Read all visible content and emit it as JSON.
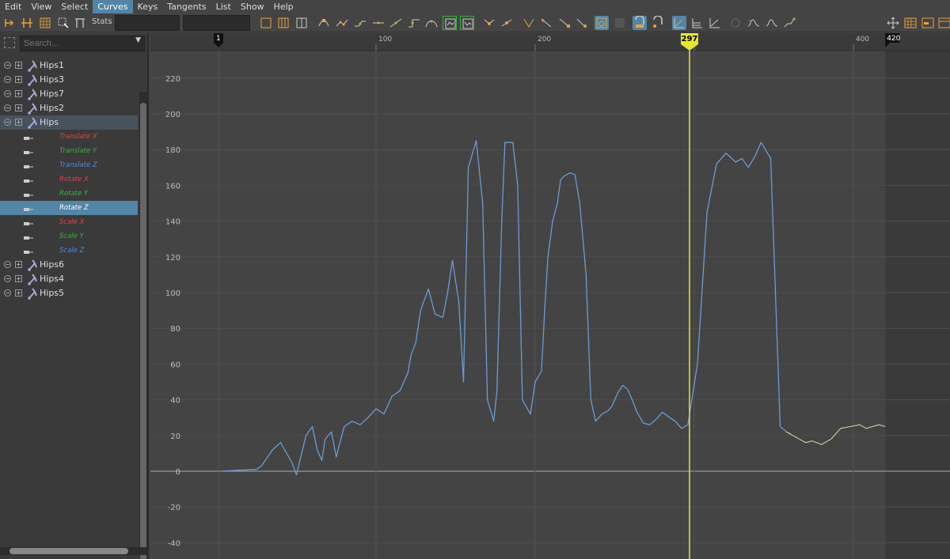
{
  "menu": [
    {
      "label": "Edit",
      "active": false
    },
    {
      "label": "View",
      "active": false
    },
    {
      "label": "Select",
      "active": false
    },
    {
      "label": "Curves",
      "active": true
    },
    {
      "label": "Keys",
      "active": false
    },
    {
      "label": "Tangents",
      "active": false
    },
    {
      "label": "List",
      "active": false
    },
    {
      "label": "Show",
      "active": false
    },
    {
      "label": "Help",
      "active": false
    }
  ],
  "toolbar": {
    "stats_label": "Stats"
  },
  "outliner": {
    "search_placeholder": "Search...",
    "items": [
      {
        "label": "Hips1",
        "type": "joint"
      },
      {
        "label": "Hips3",
        "type": "joint"
      },
      {
        "label": "Hips7",
        "type": "joint"
      },
      {
        "label": "Hips2",
        "type": "joint"
      },
      {
        "label": "Hips",
        "type": "joint",
        "highlighted": true
      },
      {
        "label": "Translate X",
        "type": "channel",
        "axis": "x"
      },
      {
        "label": "Translate Y",
        "type": "channel",
        "axis": "y"
      },
      {
        "label": "Translate Z",
        "type": "channel",
        "axis": "z"
      },
      {
        "label": "Rotate X",
        "type": "channel",
        "axis": "x"
      },
      {
        "label": "Rotate Y",
        "type": "channel",
        "axis": "y"
      },
      {
        "label": "Rotate Z",
        "type": "channel",
        "axis": "z",
        "selected": true
      },
      {
        "label": "Scale X",
        "type": "channel",
        "axis": "x"
      },
      {
        "label": "Scale Y",
        "type": "channel",
        "axis": "y"
      },
      {
        "label": "Scale Z",
        "type": "channel",
        "axis": "z"
      },
      {
        "label": "Hips6",
        "type": "joint"
      },
      {
        "label": "Hips4",
        "type": "joint"
      },
      {
        "label": "Hips5",
        "type": "joint"
      }
    ]
  },
  "graph": {
    "start_frame": "1",
    "end_frame": "420",
    "current_frame": "297",
    "x_ticks": [
      100,
      200,
      300,
      400
    ],
    "x_tick_labels": [
      "100",
      "200",
      "",
      "400"
    ],
    "y_ticks": [
      220,
      200,
      180,
      160,
      140,
      120,
      100,
      80,
      60,
      40,
      20,
      0,
      -20,
      -40
    ],
    "colors": {
      "curve": "#6b9bd6",
      "curve_tail": "#d4cf9a",
      "current_time": "#e6e62e",
      "background": "#444444",
      "out_of_range": "#3a3a3a"
    }
  },
  "chart_data": {
    "type": "line",
    "title": "",
    "xlabel": "",
    "ylabel": "",
    "xlim": [
      -40,
      460
    ],
    "ylim": [
      -50,
      230
    ],
    "series": [
      {
        "x": [
          1,
          25,
          28,
          35,
          40,
          47,
          50,
          56,
          60,
          63,
          66,
          68,
          72,
          75,
          80,
          85,
          90,
          95,
          100,
          105,
          110,
          115,
          120,
          122,
          125,
          128,
          130,
          133,
          137,
          142,
          145,
          148,
          152,
          155,
          158,
          163,
          167,
          170,
          174,
          176,
          179,
          181,
          186,
          189,
          192,
          197,
          200,
          204,
          206,
          208,
          211,
          214,
          216,
          218,
          222,
          225,
          228,
          232,
          235,
          238,
          242,
          246,
          248,
          250,
          252,
          255,
          258,
          261,
          264,
          268,
          272,
          276,
          280,
          283,
          288,
          292,
          296,
          302,
          308,
          314,
          320,
          326,
          330,
          334,
          338,
          342,
          348,
          354,
          358,
          360,
          362,
          364,
          366,
          368,
          370,
          374,
          380,
          386,
          392,
          398,
          404,
          408,
          412,
          416,
          420
        ],
        "y": [
          0,
          1,
          3,
          12,
          16,
          5,
          -2,
          20,
          25,
          12,
          6,
          18,
          22,
          8,
          25,
          28,
          26,
          30,
          35,
          32,
          42,
          45,
          55,
          65,
          72,
          90,
          95,
          102,
          88,
          86,
          100,
          118,
          95,
          50,
          170,
          185,
          150,
          40,
          28,
          45,
          140,
          184,
          184,
          160,
          40,
          32,
          50,
          56,
          90,
          120,
          140,
          150,
          163,
          165,
          167,
          166,
          150,
          110,
          40,
          28,
          32,
          34,
          36,
          40,
          44,
          48,
          46,
          40,
          33,
          27,
          26,
          29,
          33,
          31,
          28,
          24,
          26,
          60,
          145,
          172,
          178,
          173,
          175,
          170,
          176,
          184,
          175,
          25,
          22,
          21,
          20,
          19,
          18,
          17,
          16,
          17,
          15,
          18,
          24,
          25,
          26,
          24,
          25,
          26,
          25
        ]
      }
    ]
  }
}
